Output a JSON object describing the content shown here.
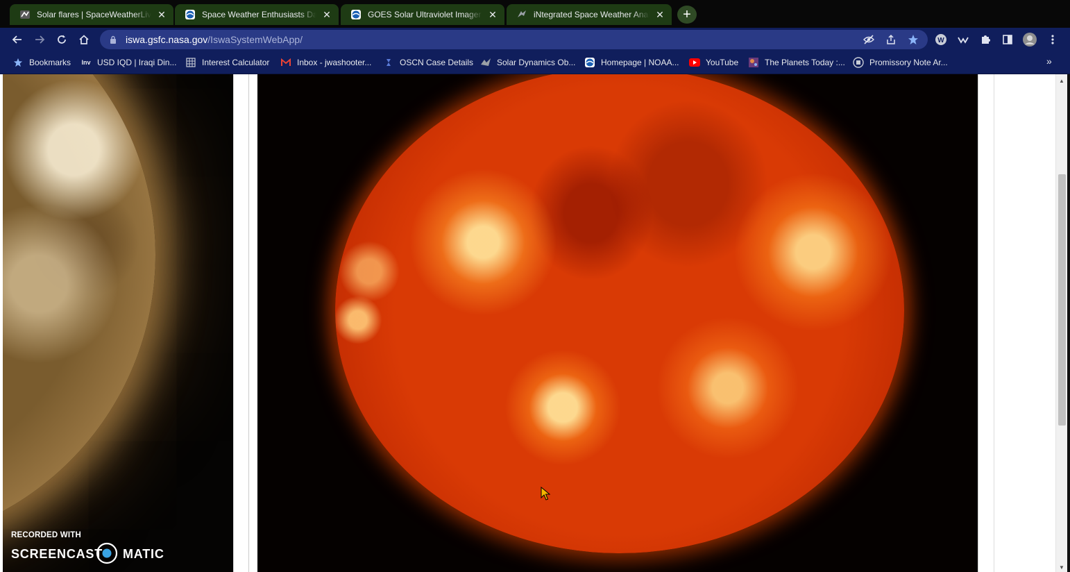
{
  "tabs": [
    {
      "title": "Solar flares | SpaceWeatherLive.com",
      "favicon": "spaceweatherlive-icon",
      "active": false
    },
    {
      "title": "Space Weather Enthusiasts Dashboard",
      "favicon": "noaa-icon",
      "active": false
    },
    {
      "title": "GOES Solar Ultraviolet Imager (SUVI)",
      "favicon": "noaa-icon",
      "active": false
    },
    {
      "title": "iNtegrated Space Weather Analysis",
      "favicon": "nasa-icon",
      "active": true
    }
  ],
  "address_bar": {
    "host": "iswa.gsfc.nasa.gov",
    "path": "/IswaSystemWebApp/"
  },
  "bookmarks": [
    {
      "label": "Bookmarks",
      "icon": "star-icon"
    },
    {
      "label": "USD IQD | Iraqi Din...",
      "icon": "investing-icon"
    },
    {
      "label": "Interest Calculator",
      "icon": "calculator-icon"
    },
    {
      "label": "Inbox - jwashooter...",
      "icon": "gmail-icon"
    },
    {
      "label": "OSCN Case Details",
      "icon": "oscn-icon"
    },
    {
      "label": "Solar Dynamics Ob...",
      "icon": "sdo-icon"
    },
    {
      "label": "Homepage | NOAA...",
      "icon": "noaa-icon"
    },
    {
      "label": "YouTube",
      "icon": "youtube-icon"
    },
    {
      "label": "The Planets Today :...",
      "icon": "planets-icon"
    },
    {
      "label": "Promissory Note Ar...",
      "icon": "document-icon"
    }
  ],
  "bookmarks_overflow": "»",
  "watermark": {
    "line1": "RECORDED WITH",
    "brand_left": "SCREENCAST",
    "brand_right": "MATIC"
  },
  "colors": {
    "tab_strip": "#080808",
    "tab_bg": "#1e3b14",
    "toolbar": "#101e5c",
    "omnibox": "#2a3a86",
    "accent_star": "#8ab4f8"
  }
}
